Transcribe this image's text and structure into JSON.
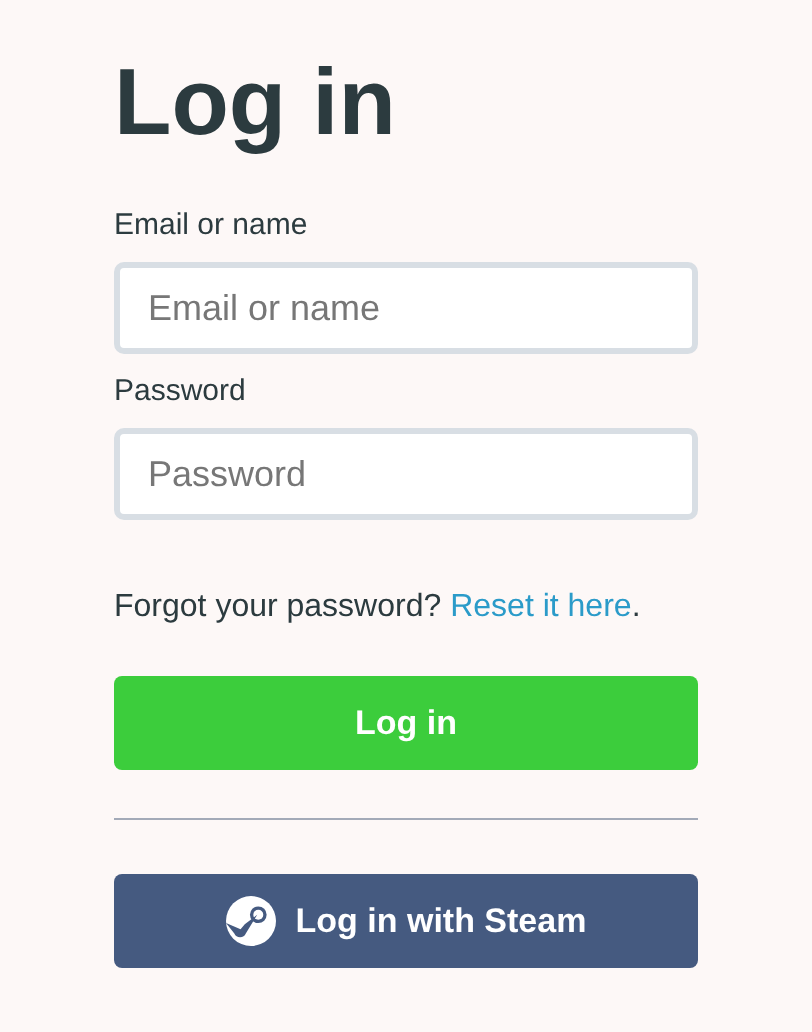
{
  "title": "Log in",
  "fields": [
    {
      "label": "Email or name",
      "placeholder": "Email or name"
    },
    {
      "label": "Password",
      "placeholder": "Password"
    }
  ],
  "forgot": {
    "text": "Forgot your password?",
    "link": "Reset it here",
    "after": "."
  },
  "login_button": "Log in",
  "steam_button": "Log in with Steam"
}
